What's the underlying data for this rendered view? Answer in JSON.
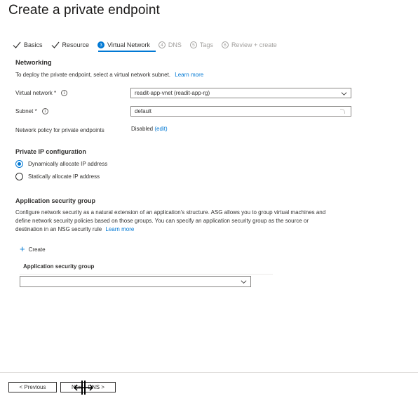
{
  "header": {
    "title": "Create a private endpoint",
    "more": "···"
  },
  "tabs": [
    {
      "label": "Basics",
      "state": "done"
    },
    {
      "label": "Resource",
      "state": "done"
    },
    {
      "num": "3",
      "label": "Virtual Network",
      "state": "active"
    },
    {
      "num": "4",
      "label": "DNS",
      "state": "disabled"
    },
    {
      "num": "5",
      "label": "Tags",
      "state": "disabled"
    },
    {
      "num": "6",
      "label": "Review + create",
      "state": "disabled"
    }
  ],
  "networking": {
    "heading": "Networking",
    "description": "To deploy the private endpoint, select a virtual network subnet.",
    "learn_more": "Learn more",
    "vnet_label": "Virtual network *",
    "vnet_value": "readit-app-vnet (readit-app-rg)",
    "subnet_label": "Subnet *",
    "subnet_value": "default",
    "policy_label": "Network policy for private endpoints",
    "policy_value": "Disabled",
    "policy_edit": "(edit)"
  },
  "private_ip": {
    "heading": "Private IP configuration",
    "dynamic_label": "Dynamically allocate IP address",
    "static_label": "Statically allocate IP address",
    "selected": "dynamic"
  },
  "asg": {
    "heading": "Application security group",
    "description_1": "Configure network security as a natural extension of an application's structure. ASG allows you to group virtual machines and",
    "description_2": "define network security policies based on those groups. You can specify an application security group as the source or",
    "description_3": "destination in an NSG security rule",
    "learn_more": "Learn more",
    "create_label": "Create",
    "column_header": "Application security group",
    "select_value": ""
  },
  "footer": {
    "previous_label": "< Previous",
    "next_label": "Next : DNS >"
  },
  "colors": {
    "accent": "#0078d4",
    "text": "#323130",
    "disabled": "#a19f9d"
  }
}
